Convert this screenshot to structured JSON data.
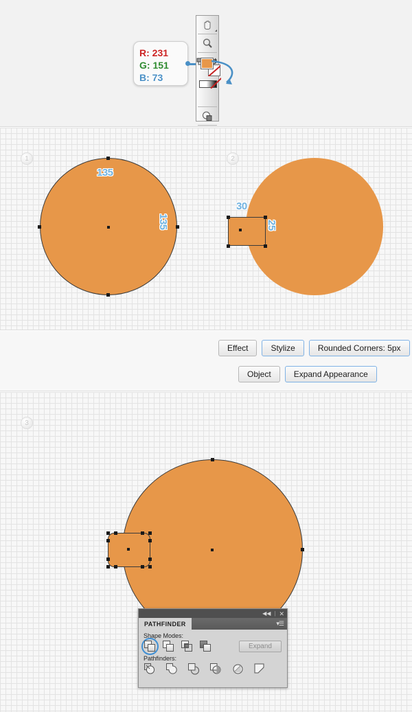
{
  "colorCallout": {
    "lines": [
      {
        "channel": "R:",
        "value": "231",
        "hex": "#cc2222"
      },
      {
        "channel": "G:",
        "value": "151",
        "hex": "#2f8b30"
      },
      {
        "channel": "B:",
        "value": "73",
        "hex": "#4a90c6"
      }
    ],
    "fill_color": "#e79749"
  },
  "toolbar": {
    "tools": [
      {
        "name": "hand-tool"
      },
      {
        "name": "zoom-tool"
      },
      {
        "name": "artboard-tool"
      },
      {
        "name": "swap-fill-stroke-tool"
      },
      {
        "name": "fill-stroke-swatch"
      },
      {
        "name": "gradient-none-bar"
      },
      {
        "name": "draw-mode-tool"
      },
      {
        "name": "screen-mode-tool"
      }
    ]
  },
  "steps": {
    "one": "1",
    "two": "2",
    "three": "3"
  },
  "shapes": {
    "circle1": {
      "w": "135",
      "h": "135"
    },
    "rect1": {
      "w": "30",
      "h": "25"
    }
  },
  "menuPaths": {
    "row1": [
      {
        "label": "Effect",
        "highlight": false
      },
      {
        "label": "Stylize",
        "highlight": true
      },
      {
        "label": "Rounded Corners: 5px",
        "highlight": true
      }
    ],
    "row2": [
      {
        "label": "Object",
        "highlight": false
      },
      {
        "label": "Expand Appearance",
        "highlight": true
      }
    ]
  },
  "pathfinder": {
    "title": "PATHFINDER",
    "collapse_glyph": "◀◀",
    "close_glyph": "✕",
    "menu_glyph": "▾☰",
    "shape_modes_label": "Shape Modes:",
    "pathfinders_label": "Pathfinders:",
    "expand_label": "Expand",
    "shape_modes": [
      {
        "name": "unite-icon",
        "selected": true
      },
      {
        "name": "minus-front-icon",
        "selected": false
      },
      {
        "name": "intersect-icon",
        "selected": false
      },
      {
        "name": "exclude-icon",
        "selected": false
      }
    ],
    "pathfinders": [
      {
        "name": "divide-icon"
      },
      {
        "name": "trim-icon"
      },
      {
        "name": "merge-icon"
      },
      {
        "name": "crop-icon"
      },
      {
        "name": "outline-icon"
      },
      {
        "name": "minus-back-icon"
      }
    ],
    "accent_color": "#3f8fd4"
  }
}
